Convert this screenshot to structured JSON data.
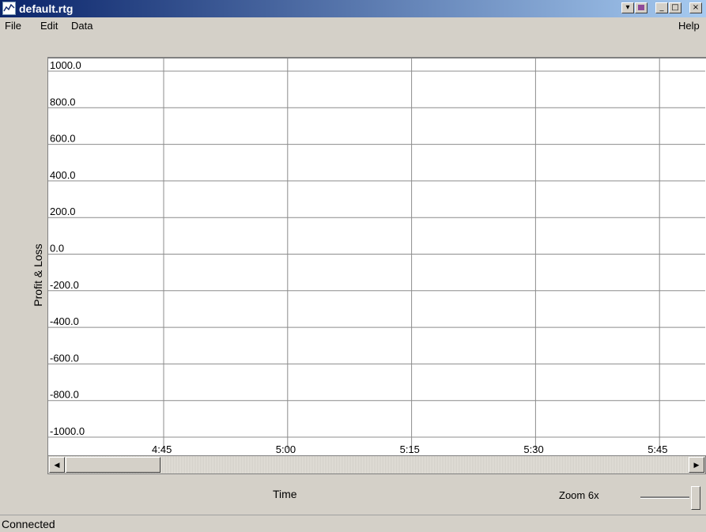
{
  "window": {
    "title": "default.rtg",
    "controls": [
      "minimize",
      "maximize",
      "close"
    ]
  },
  "menu": {
    "left": [
      "File",
      "Edit",
      "Data"
    ],
    "right": "Help"
  },
  "chart_data": {
    "type": "line",
    "ylabel": "Profit & Loss",
    "xlabel": "Time",
    "y_ticks": [
      "1000.0",
      "800.0",
      "600.0",
      "400.0",
      "200.0",
      "0.0",
      "-200.0",
      "-400.0",
      "-600.0",
      "-800.0",
      "-1000.0"
    ],
    "x_ticks": [
      "4:45",
      "5:00",
      "5:15",
      "5:30",
      "5:45"
    ],
    "ylim": [
      -1000,
      1000
    ],
    "grid": true,
    "series": []
  },
  "zoom": {
    "label": "Zoom 6x"
  },
  "status": {
    "text": "Connected"
  }
}
